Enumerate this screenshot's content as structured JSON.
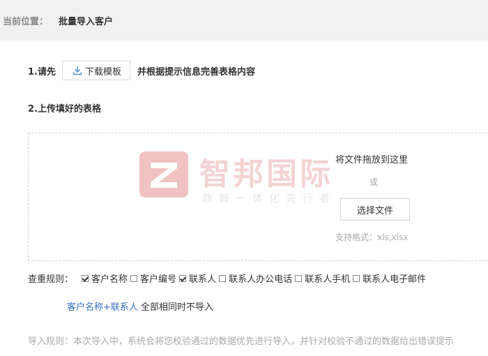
{
  "breadcrumb": {
    "label": "当前位置：",
    "current": "批量导入客户"
  },
  "step1": {
    "prefix": "1.请先",
    "button_label": "下载模板",
    "suffix": "并根据提示信息完善表格内容"
  },
  "step2": {
    "label": "2.上传填好的表格"
  },
  "dropzone": {
    "drag_text": "将文件拖放到这里",
    "or_text": "或",
    "choose_label": "选择文件",
    "formats": "支持格式：xls,xlsx"
  },
  "watermark": {
    "name": "智邦国际",
    "slogan": "数智一体化先行者"
  },
  "dedup": {
    "label": "查重规则：",
    "options": [
      {
        "label": "客户名称",
        "checked": true
      },
      {
        "label": "客户编号",
        "checked": false
      },
      {
        "label": "联系人",
        "checked": true
      },
      {
        "label": "联系人办公电话",
        "checked": false
      },
      {
        "label": "联系人手机",
        "checked": false
      },
      {
        "label": "联系人电子邮件",
        "checked": false
      }
    ]
  },
  "summary": {
    "highlight": "客户名称+联系人",
    "text": " 全部相同时不导入"
  },
  "import_rule": "导入规则：本次导入中，系统会将您校验通过的数据优先进行导入，并针对校验不通过的数据给出错误提示",
  "colors": {
    "link": "#3a6ec2",
    "download_icon": "#4a90d9",
    "watermark": "#e27a7a"
  }
}
